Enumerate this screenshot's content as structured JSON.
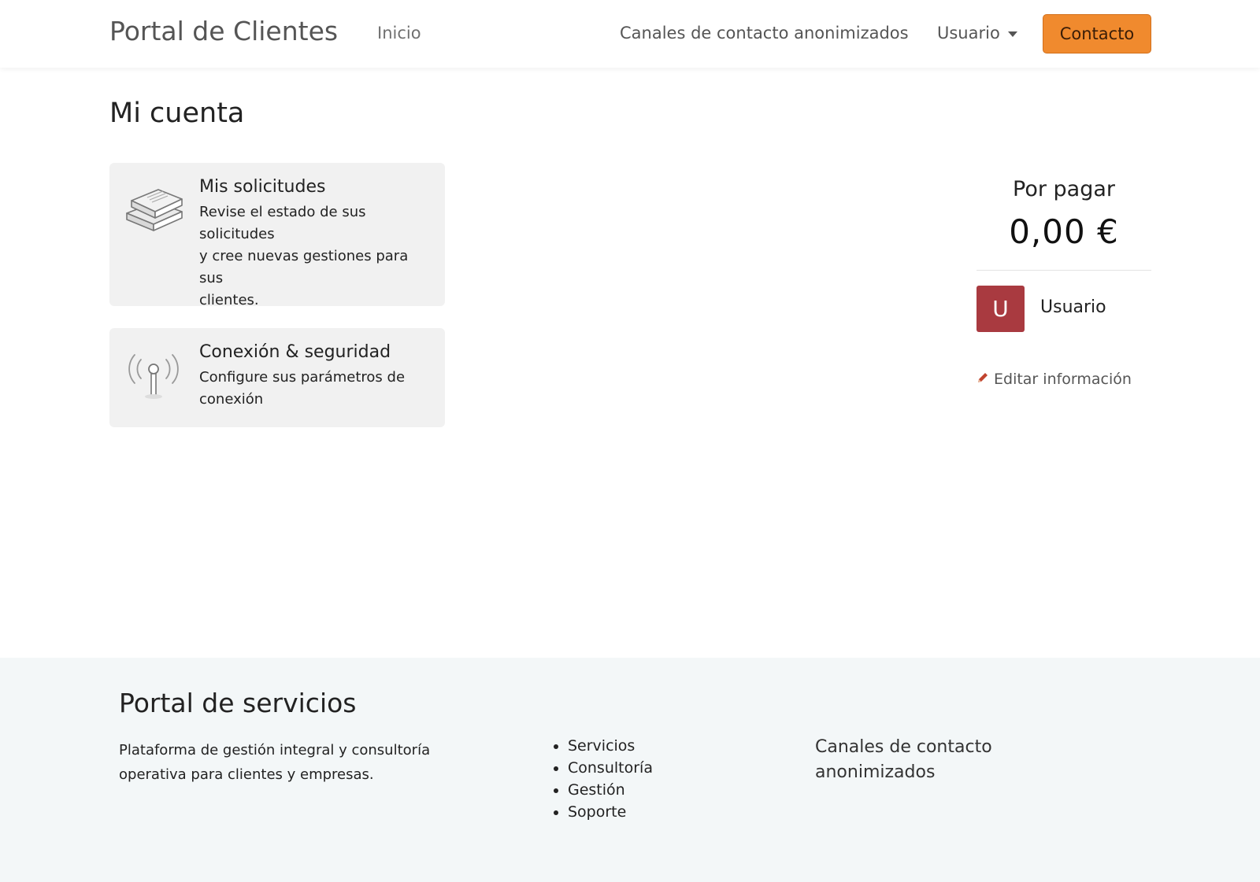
{
  "header": {
    "brand": "Portal de Clientes",
    "nav_home": "Inicio",
    "nav_channels": "Canales de contacto anonimizados",
    "user_menu": "Usuario",
    "contact_button": "Contacto"
  },
  "main": {
    "title": "Mi cuenta",
    "cards": [
      {
        "title": "Mis solicitudes",
        "text_lines": [
          "Revise el estado de sus",
          "solicitudes",
          "y cree nuevas gestiones para sus",
          "clientes."
        ],
        "icon": "books-icon"
      },
      {
        "title": "Conexión & seguridad",
        "text_lines": [
          "Configure sus parámetros de",
          "conexión"
        ],
        "icon": "antenna-icon"
      }
    ]
  },
  "account": {
    "due_label": "Por pagar",
    "due_amount": "0,00 €",
    "avatar_initial": "U",
    "user_name": "Usuario",
    "edit_link": "Editar información",
    "avatar_color": "#a93a40"
  },
  "footer": {
    "title": "Portal de servicios",
    "description_lines": [
      "Plataforma de gestión integral y consultoría",
      "operativa para clientes y empresas."
    ],
    "links": [
      "Servicios",
      "Consultoría",
      "Gestión",
      "Soporte"
    ],
    "channels_lines": [
      "Canales de contacto",
      "anonimizados"
    ]
  },
  "colors": {
    "accent": "#f08a2e",
    "card_bg": "#f1f1f1",
    "footer_bg": "#f3f7f8"
  }
}
